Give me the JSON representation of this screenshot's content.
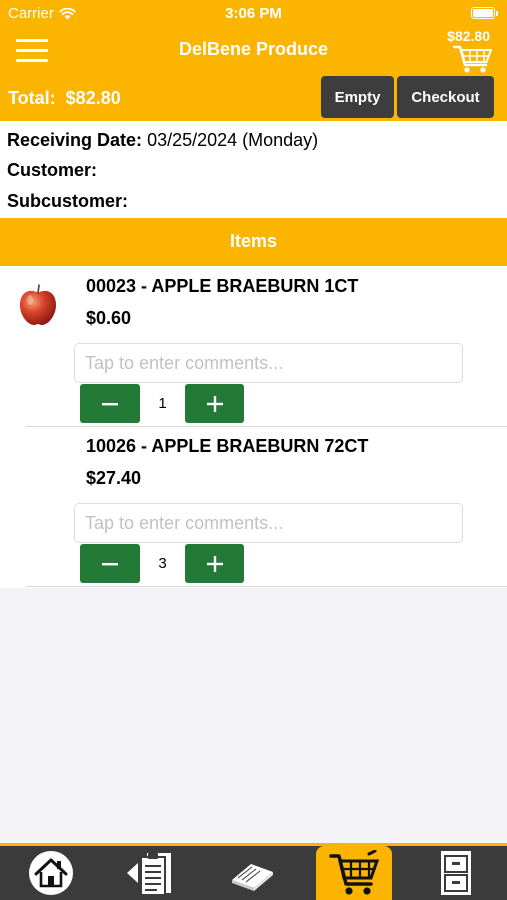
{
  "status": {
    "carrier": "Carrier",
    "time": "3:06 PM"
  },
  "nav": {
    "title": "DelBene Produce",
    "cart_amount": "$82.80"
  },
  "summary": {
    "total_label": "Total:",
    "total_value": "$82.80",
    "empty_label": "Empty",
    "checkout_label": "Checkout"
  },
  "info": {
    "receiving_label": "Receiving Date:",
    "receiving_value": "03/25/2024 (Monday)",
    "customer_label": "Customer:",
    "subcustomer_label": "Subcustomer:"
  },
  "items_header": "Items",
  "items": [
    {
      "title": "00023 - APPLE BRAEBURN 1CT",
      "price": "$0.60",
      "comment_placeholder": "Tap to enter comments...",
      "quantity": "1"
    },
    {
      "title": "10026 - APPLE BRAEBURN 72CT",
      "price": "$27.40",
      "comment_placeholder": "Tap to enter comments...",
      "quantity": "3"
    }
  ],
  "tabs": [
    {
      "icon": "home-icon"
    },
    {
      "icon": "order-history-icon"
    },
    {
      "icon": "catalog-icon"
    },
    {
      "icon": "cart-icon",
      "active": true
    },
    {
      "icon": "cabinet-icon"
    }
  ],
  "colors": {
    "accent": "#fbb400",
    "dark_button": "#3d3d3d",
    "stepper": "#237a37",
    "tab_bar": "#3b3b3b"
  }
}
